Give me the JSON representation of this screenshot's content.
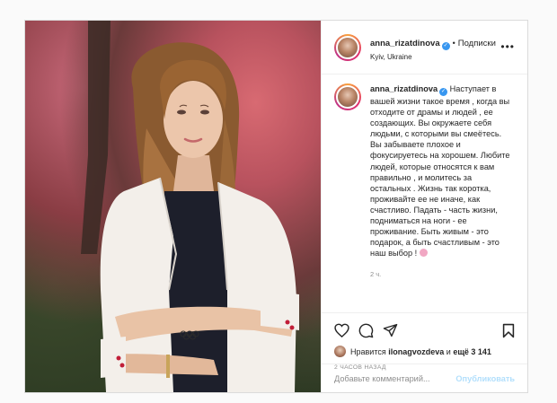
{
  "post": {
    "author": {
      "username": "anna_rizatdinova",
      "location": "Kyiv, Ukraine",
      "follow_label": "Подписки",
      "verified": true
    },
    "caption": {
      "username": "anna_rizatdinova",
      "text": "Наступает в вашей жизни такое время , когда вы отходите от драмы и людей , ее создающих. Вы окружаете себя людьми, с которыми вы смеётесь. Вы забываете плохое и фокусируетесь на хорошем. Любите людей, которые относятся к вам правильно , и молитесь за остальных . Жизнь так коротка, проживайте ее не иначе, как счастливо. Падать - часть жизни, подниматься на ноги - ее проживание. Быть живым - это подарок, а быть счастливым - это наш выбор !",
      "time": "2 ч."
    },
    "likes": {
      "prefix": "Нравится",
      "user": "ilonagvozdeva",
      "connector": "и",
      "others": "ещё 3 141"
    },
    "posted_ago": "2 ЧАСОВ НАЗАД",
    "comment": {
      "placeholder": "Добавьте комментарий...",
      "publish_label": "Опубликовать"
    }
  },
  "icons": {
    "more": "more-icon",
    "like": "heart-icon",
    "comment": "comment-icon",
    "share": "share-icon",
    "save": "bookmark-icon",
    "verified": "verified-badge-icon"
  },
  "colors": {
    "accent_blue": "#3897f0",
    "publish_disabled": "#b2dffc",
    "muted_text": "#8e8e8e"
  }
}
